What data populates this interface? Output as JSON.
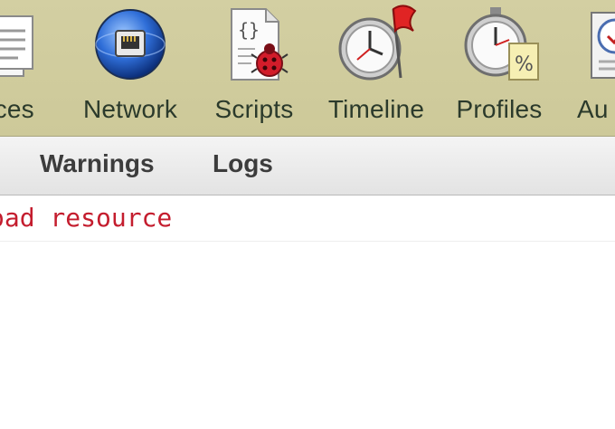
{
  "toolbar": {
    "items": [
      {
        "label": "rces",
        "icon": "resources-icon"
      },
      {
        "label": "Network",
        "icon": "network-icon"
      },
      {
        "label": "Scripts",
        "icon": "scripts-icon"
      },
      {
        "label": "Timeline",
        "icon": "timeline-icon"
      },
      {
        "label": "Profiles",
        "icon": "profiles-icon"
      },
      {
        "label": "Au",
        "icon": "audits-icon"
      }
    ]
  },
  "filters": {
    "warnings": "Warnings",
    "logs": "Logs"
  },
  "console": {
    "message": "oad resource"
  },
  "colors": {
    "toolbar_bg": "#d0cc9e",
    "error_text": "#c41d2e"
  }
}
